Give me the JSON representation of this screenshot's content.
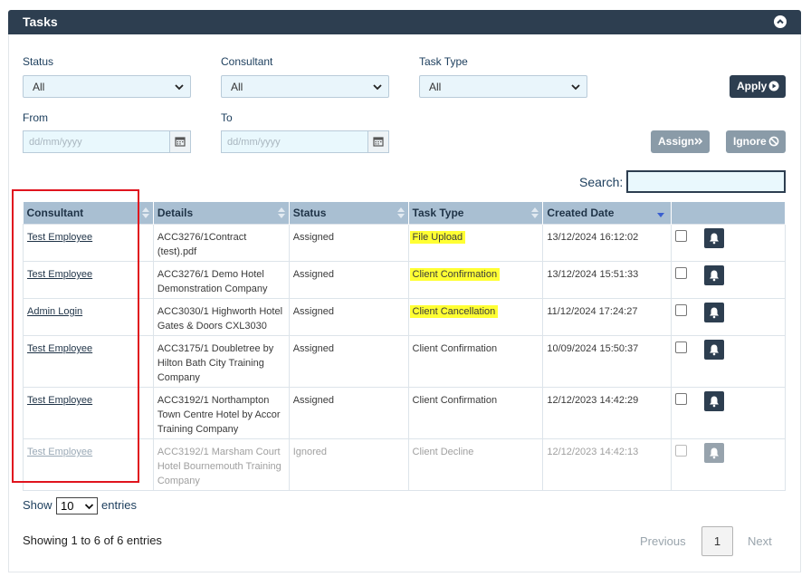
{
  "panel": {
    "title": "Tasks"
  },
  "filters": {
    "status": {
      "label": "Status",
      "value": "All"
    },
    "consultant": {
      "label": "Consultant",
      "value": "All"
    },
    "task_type": {
      "label": "Task Type",
      "value": "All"
    },
    "from": {
      "label": "From",
      "placeholder": "dd/mm/yyyy"
    },
    "to": {
      "label": "To",
      "placeholder": "dd/mm/yyyy"
    }
  },
  "buttons": {
    "apply": "Apply",
    "assign": "Assign",
    "ignore": "Ignore"
  },
  "search": {
    "label": "Search:"
  },
  "table": {
    "headers": [
      "Consultant",
      "Details",
      "Status",
      "Task Type",
      "Created Date"
    ],
    "rows": [
      {
        "consultant": "Test Employee",
        "details": "ACC3276/1Contract (test).pdf",
        "status": "Assigned",
        "task_type": "File Upload",
        "created": "13/12/2024 16:12:02"
      },
      {
        "consultant": "Test Employee",
        "details": "ACC3276/1 Demo Hotel Demonstration Company",
        "status": "Assigned",
        "task_type": "Client Confirmation",
        "created": "13/12/2024 15:51:33"
      },
      {
        "consultant": "Admin Login",
        "details": "ACC3030/1 Highworth Hotel Gates & Doors CXL3030",
        "status": "Assigned",
        "task_type": "Client Cancellation",
        "created": "11/12/2024 17:24:27"
      },
      {
        "consultant": "Test Employee",
        "details": "ACC3175/1 Doubletree by Hilton Bath City Training Company",
        "status": "Assigned",
        "task_type": "Client Confirmation",
        "created": "10/09/2024 15:50:37"
      },
      {
        "consultant": "Test Employee",
        "details": "ACC3192/1 Northampton Town Centre Hotel by Accor Training Company",
        "status": "Assigned",
        "task_type": "Client Confirmation",
        "created": "12/12/2023 14:42:29"
      },
      {
        "consultant": "Test Employee",
        "details": "ACC3192/1 Marsham Court Hotel Bournemouth Training Company",
        "status": "Ignored",
        "task_type": "Client Decline",
        "created": "12/12/2023 14:42:13"
      }
    ]
  },
  "footer": {
    "show": "Show",
    "page_length": "10",
    "entries": "entries",
    "info": "Showing 1 to 6 of 6 entries",
    "previous": "Previous",
    "current_page": "1",
    "next": "Next"
  },
  "colors": {
    "header_bg": "#2d3e50",
    "highlight": "#ffff33",
    "annotation": "#e0141e",
    "th_bg": "#a9bfd2"
  },
  "icons": [
    "chevron-up-icon",
    "chevron-down-icon",
    "calendar-icon",
    "play-circle-icon",
    "double-chevron-right-icon",
    "ban-icon",
    "sort-icon",
    "bell-icon"
  ]
}
